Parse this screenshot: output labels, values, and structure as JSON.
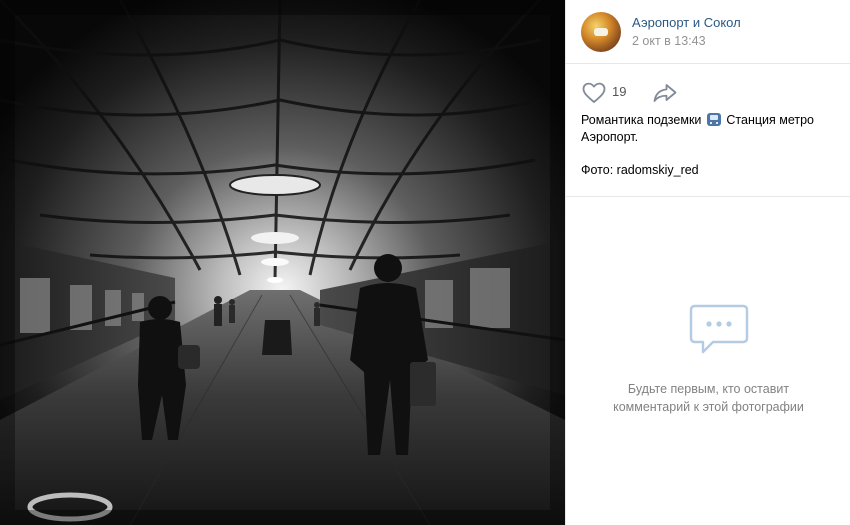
{
  "photo": {
    "subject": "metro-station-platform-photo"
  },
  "post": {
    "group_name": "Аэропорт и Сокол",
    "date": "2 окт в 13:43",
    "likes": "19",
    "desc_part1": "Романтика подземки",
    "desc_part2": "Станция метро Аэропорт.",
    "photo_credit": "Фото: radomskiy_red"
  },
  "comments": {
    "empty_line1": "Будьте первым, кто оставит",
    "empty_line2": "комментарий к этой фотографии"
  },
  "icons": {
    "like": "heart-icon",
    "share": "share-arrow-icon",
    "metro": "metro-emoji-icon",
    "comments": "comments-icon"
  },
  "colors": {
    "link": "#2a5885",
    "muted": "#939393",
    "icon": "#828a99",
    "empty_icon": "#b3cbe3"
  }
}
